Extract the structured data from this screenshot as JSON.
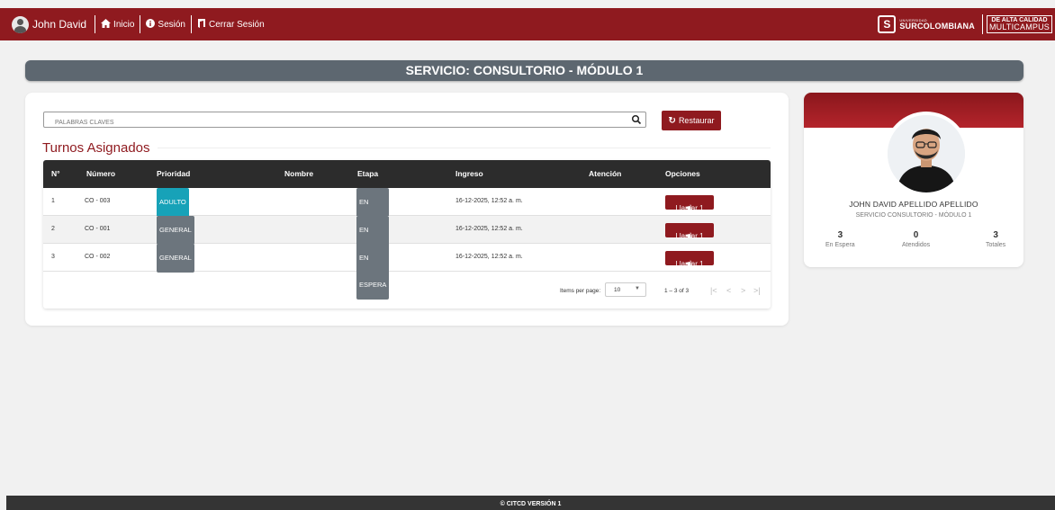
{
  "nav": {
    "user_name": "John David",
    "items": [
      {
        "icon": "home-icon",
        "glyph": "⌂",
        "label": "Inicio"
      },
      {
        "icon": "info-circle-icon",
        "glyph": "●",
        "label": "Sesión"
      },
      {
        "icon": "exit-door-icon",
        "glyph": "▌",
        "label": "Cerrar Sesión"
      }
    ],
    "logo": {
      "university_small": "UNIVERSIDAD",
      "university": "SURCOLOMBIANA",
      "accreditation_top": "DE ALTA CALIDAD",
      "accreditation_bottom": "MULTICAMPUS"
    }
  },
  "service_title": "SERVICIO: CONSULTORIO - MÓDULO 1",
  "search": {
    "placeholder": "PALABRAS CLAVES",
    "value": ""
  },
  "restore_button": "Restaurar",
  "section_title": "Turnos Asignados",
  "table": {
    "columns": [
      "N°",
      "Número",
      "Prioridad",
      "Nombre",
      "Etapa",
      "Ingreso",
      "Atención",
      "Opciones"
    ],
    "rows": [
      {
        "n": "1",
        "numero": "CO - 003",
        "prioridad": "ADULTO MAYOR",
        "prioridad_color": "#17a2b8",
        "nombre": "",
        "etapa": "EN ESPERA",
        "ingreso": "16-12-2025, 12:52 a. m.",
        "atencion": "",
        "action": "Llamar 1"
      },
      {
        "n": "2",
        "numero": "CO - 001",
        "prioridad": "GENERAL",
        "prioridad_color": "#6c757d",
        "nombre": "",
        "etapa": "EN ESPERA",
        "ingreso": "16-12-2025, 12:52 a. m.",
        "atencion": "",
        "action": "Llamar 1"
      },
      {
        "n": "3",
        "numero": "CO - 002",
        "prioridad": "GENERAL",
        "prioridad_color": "#6c757d",
        "nombre": "",
        "etapa": "EN ESPERA",
        "ingreso": "16-12-2025, 12:52 a. m.",
        "atencion": "",
        "action": "Llamar 1"
      }
    ]
  },
  "paginator": {
    "label": "Items per page:",
    "page_size": "10",
    "range": "1 – 3 of 3"
  },
  "profile": {
    "name": "JOHN DAVID APELLIDO APELLIDO",
    "subtitle": "SERVICIO CONSULTORIO - MÓDULO 1",
    "stats": [
      {
        "value": "3",
        "label": "En Espera"
      },
      {
        "value": "0",
        "label": "Atendidos"
      },
      {
        "value": "3",
        "label": "Totales"
      }
    ]
  },
  "footer": "© CITCD VERSIÓN 1",
  "colors": {
    "brand": "#8f1a1f",
    "banner": "#5d6770",
    "table_header": "#2c2c2c",
    "badge_teal": "#17a2b8",
    "badge_gray": "#6c757d"
  }
}
